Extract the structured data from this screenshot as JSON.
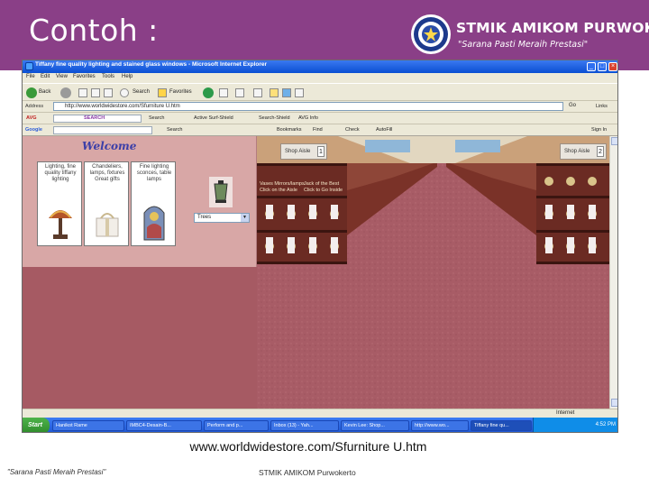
{
  "slide": {
    "title": "Contoh :",
    "caption": "www.worldwidestore.com/Sfurniture U.htm",
    "colors": {
      "header": "#8a3f87",
      "page_background": "#a65a63"
    }
  },
  "logo": {
    "name": "STMIK AMIKOM PURWOKERTO",
    "motto": "\"Sarana Pasti Meraih Prestasi\"",
    "seal_text": "AMIKOM"
  },
  "footer": {
    "motto": "\"Sarana Pasti Meraih Prestasi\"",
    "name": "STMIK AMIKOM Purwokerto"
  },
  "browser": {
    "title": "Tiffany fine quality lighting and stained glass windows - Microsoft Internet Explorer",
    "menu": [
      "File",
      "Edit",
      "View",
      "Favorites",
      "Tools",
      "Help"
    ],
    "toolbar": {
      "back": "Back",
      "search": "Search",
      "favorites": "Favorites"
    },
    "address_label": "Address",
    "address": "http://www.worldwidestore.com/Sfurniture U.htm",
    "go": "Go",
    "links": "Links",
    "avg_bar": {
      "search_label": "SEARCH",
      "search_button": "Search",
      "active_surf": "Active Surf-Shield",
      "search_shield": "Search-Shield",
      "avg_info": "AVG Info"
    },
    "google_bar": {
      "google": "Google",
      "search": "Search",
      "bookmarks": "Bookmarks",
      "find": "Find",
      "check": "Check",
      "autofill": "AutoFill",
      "sign_in": "Sign In"
    },
    "status_zone": "Internet"
  },
  "webpage": {
    "welcome": "Welcome",
    "cards": [
      {
        "label": "Lighting, fine quality tiffany lighting"
      },
      {
        "label": "Chandeliers, lamps, fixtures Great gifts"
      },
      {
        "label": "Fine lighting sconces, table lamps"
      }
    ],
    "select_value": "Trees",
    "aisle_signs": [
      {
        "label": "Shop Aisle",
        "number": "1"
      },
      {
        "label": "Shop Aisle",
        "number": "2"
      }
    ],
    "shelf_links": [
      "Vases Mirrors/lamps",
      "Click on the Aisle",
      "Jack of the Best",
      "Click to Go Inside"
    ]
  },
  "taskbar": {
    "start": "Start",
    "tasks": [
      {
        "label": "Hanikot Rame"
      },
      {
        "label": "IMBC4-Desain-B..."
      },
      {
        "label": "Perform and p..."
      },
      {
        "label": "Inbox (13) - Yah..."
      },
      {
        "label": "Kevin Lee: Shop..."
      },
      {
        "label": "http://www.wo..."
      },
      {
        "label": "Tiffany fine qu..."
      }
    ],
    "clock": "4:52 PM"
  }
}
